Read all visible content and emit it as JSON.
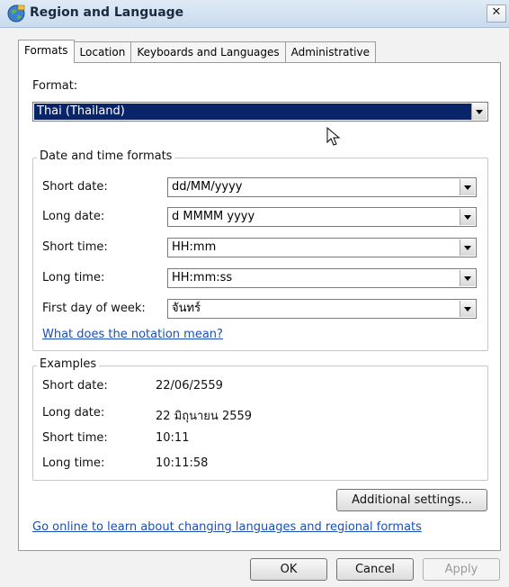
{
  "window": {
    "title": "Region and Language"
  },
  "tabs": [
    {
      "label": "Formats"
    },
    {
      "label": "Location"
    },
    {
      "label": "Keyboards and Languages"
    },
    {
      "label": "Administrative"
    }
  ],
  "format": {
    "label": "Format:",
    "value": "Thai (Thailand)"
  },
  "date_time": {
    "title": "Date and time formats",
    "rows": [
      {
        "label": "Short date:",
        "value": "dd/MM/yyyy"
      },
      {
        "label": "Long date:",
        "value": "d MMMM yyyy"
      },
      {
        "label": "Short time:",
        "value": "HH:mm"
      },
      {
        "label": "Long time:",
        "value": "HH:mm:ss"
      },
      {
        "label": "First day of week:",
        "value": "จันทร์"
      }
    ],
    "notation_link": "What does the notation mean?"
  },
  "examples": {
    "title": "Examples",
    "rows": [
      {
        "label": "Short date:",
        "value": "22/06/2559"
      },
      {
        "label": "Long date:",
        "value": "22 มิถุนายน 2559"
      },
      {
        "label": "Short time:",
        "value": "10:11"
      },
      {
        "label": "Long time:",
        "value": "10:11:58"
      }
    ]
  },
  "additional_settings": "Additional settings...",
  "online_link": "Go online to learn about changing languages and regional formats",
  "buttons": {
    "ok": "OK",
    "cancel": "Cancel",
    "apply": "Apply"
  },
  "icons": {
    "title": "globe-icon",
    "close": "close-icon",
    "dropdown": "chevron-down-icon",
    "cursor": "mouse-pointer-icon"
  },
  "colors": {
    "selection": "#0a246a",
    "link": "#1a4fb5",
    "titlebar": "#c9dbee"
  }
}
